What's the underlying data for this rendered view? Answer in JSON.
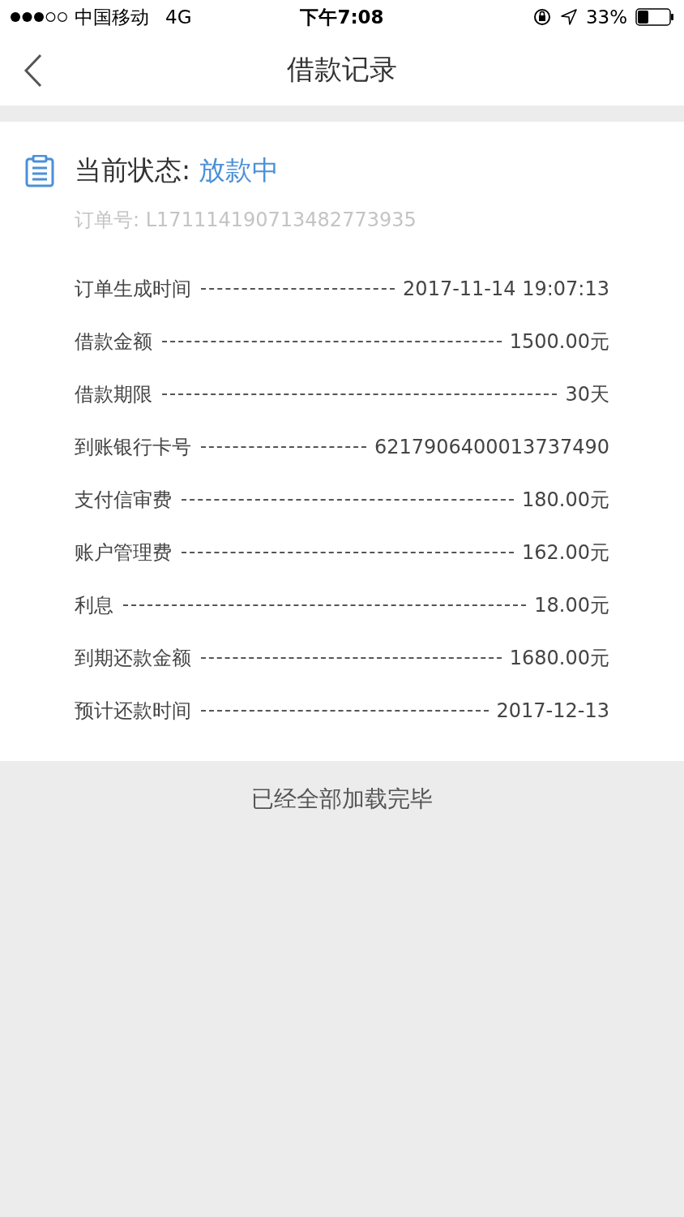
{
  "status_bar": {
    "carrier": "中国移动",
    "network": "4G",
    "time": "下午7:08",
    "battery": "33%"
  },
  "nav": {
    "title": "借款记录"
  },
  "record": {
    "status_label": "当前状态:",
    "status_value": "放款中",
    "order_number": "订单号: L171114190713482773935",
    "rows": [
      {
        "label": "订单生成时间",
        "value": "2017-11-14 19:07:13"
      },
      {
        "label": "借款金额",
        "value": "1500.00元"
      },
      {
        "label": "借款期限",
        "value": "30天"
      },
      {
        "label": "到账银行卡号",
        "value": "6217906400013737490"
      },
      {
        "label": "支付信审费",
        "value": "180.00元"
      },
      {
        "label": "账户管理费",
        "value": "162.00元"
      },
      {
        "label": "利息",
        "value": "18.00元"
      },
      {
        "label": "到期还款金额",
        "value": "1680.00元"
      },
      {
        "label": "预计还款时间",
        "value": "2017-12-13"
      }
    ]
  },
  "footer": {
    "text": "已经全部加载完毕"
  }
}
